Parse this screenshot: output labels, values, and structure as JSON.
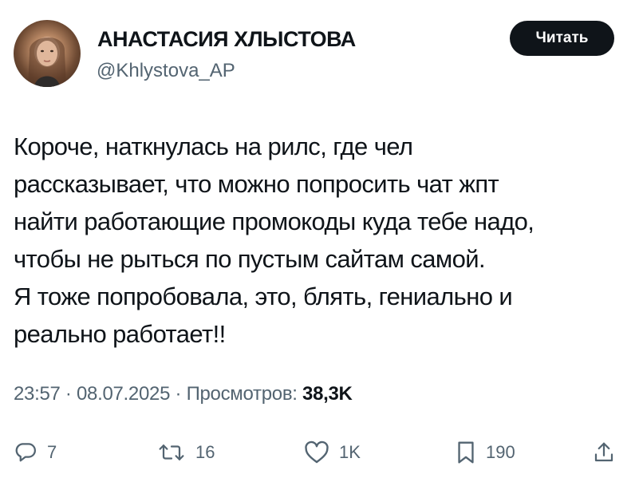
{
  "author": {
    "display_name": "АНАСТАСИЯ ХЛЫСТОВА",
    "handle": "@Khlystova_AP"
  },
  "follow_button": {
    "label": "Читать"
  },
  "tweet": {
    "lines": [
      "Короче, наткнулась на рилс, где чел",
      "рассказывает, что можно попросить чат жпт",
      "найти работающие промокоды куда тебе надо,",
      "чтобы не рыться по пустым сайтам самой.",
      "Я тоже попробовала, это, блять, гениально и",
      "реально работает!!"
    ]
  },
  "meta": {
    "time": "23:57",
    "separator": " · ",
    "date": "08.07.2025",
    "views_label": "Просмотров:",
    "views_count": "38,3K"
  },
  "actions": {
    "replies": "7",
    "retweets": "16",
    "likes": "1K",
    "bookmarks": "190"
  }
}
